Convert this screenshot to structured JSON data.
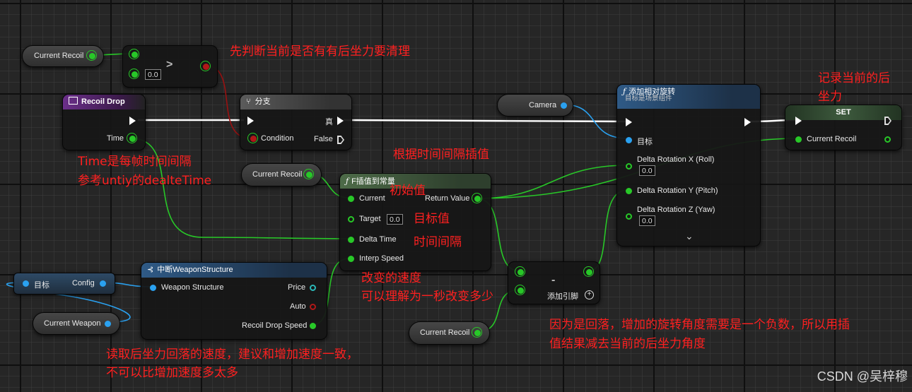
{
  "nodes": {
    "current_recoil_1": {
      "label": "Current Recoil"
    },
    "compare": {
      "value": "0.0",
      "op": ">"
    },
    "recoil_drop": {
      "title": "Recoil Drop",
      "time_label": "Time"
    },
    "branch": {
      "title": "分支",
      "condition": "Condition",
      "true_label": "真",
      "false_label": "False"
    },
    "camera": {
      "label": "Camera"
    },
    "add_rotation": {
      "title": "添加相对旋转",
      "subtitle": "目标是场景组件",
      "target": "目标",
      "x_label": "Delta Rotation X (Roll)",
      "x_value": "0.0",
      "y_label": "Delta Rotation Y (Pitch)",
      "z_label": "Delta Rotation Z (Yaw)",
      "z_value": "0.0",
      "expand": "⌄"
    },
    "set": {
      "title": "SET",
      "var": "Current Recoil"
    },
    "current_recoil_2": {
      "label": "Current Recoil"
    },
    "finterp": {
      "title": "F插值到常量",
      "current": "Current",
      "return_value": "Return Value",
      "target": "Target",
      "target_value": "0.0",
      "delta_time": "Delta Time",
      "interp_speed": "Interp Speed"
    },
    "target_config": {
      "target": "目标",
      "config": "Config"
    },
    "current_weapon": {
      "label": "Current Weapon"
    },
    "break_struct": {
      "title": "中断WeaponStructure",
      "input": "Weapon Structure",
      "price": "Price",
      "auto": "Auto",
      "recoil_speed": "Recoil Drop Speed"
    },
    "subtract": {
      "op": "-",
      "add_pin": "添加引脚"
    },
    "current_recoil_3": {
      "label": "Current Recoil"
    }
  },
  "annotations": {
    "a1": "先判断当前是否有有后坐力要清理",
    "a2_line1": "记录当前的后",
    "a2_line2": "坐力",
    "a3_line1": "Time是每帧时间间隔",
    "a3_line2": "参考untiy的dealteTime",
    "a4": "根据时间间隔插值",
    "a5": "初始值",
    "a6": "目标值",
    "a7": "时间间隔",
    "a8_line1": "改变的速度",
    "a8_line2": "可以理解为一秒改变多少",
    "a9_line1": "因为是回落，增加的旋转角度需要是一个负数，所以用插",
    "a9_line2": "值结果减去当前的后坐力角度",
    "a10_line1": "读取后坐力回落的速度，建议和增加速度一致，",
    "a10_line2": "不可以比增加速度多太多"
  },
  "watermark": "CSDN @吴梓穆",
  "colors": {
    "float_pin": "#28c828",
    "object_pin": "#2aa1f0",
    "bool_pin": "#b01818",
    "annotation": "#ff2020",
    "exec_wire": "#ffffff"
  }
}
